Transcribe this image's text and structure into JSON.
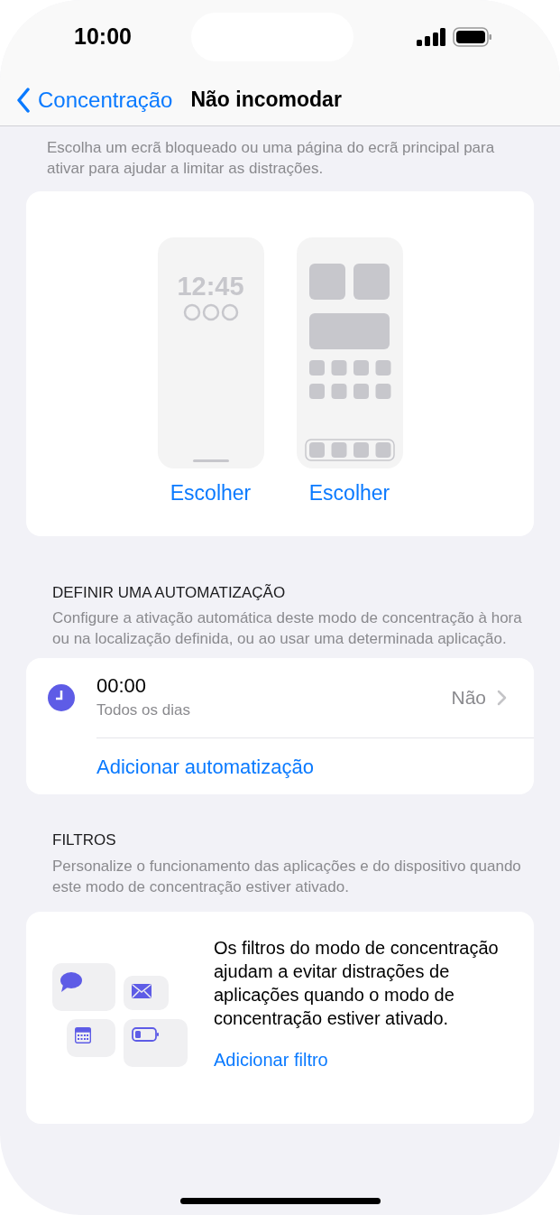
{
  "status_bar": {
    "time": "10:00"
  },
  "nav": {
    "back_label": "Concentração",
    "title": "Não incomodar"
  },
  "screens_section": {
    "description": "Escolha um ecrã bloqueado ou uma página do ecrã principal para ativar para ajudar a limitar as distrações.",
    "previews": [
      {
        "kind": "lock",
        "time": "12:45",
        "action": "Escolher"
      },
      {
        "kind": "home",
        "action": "Escolher"
      }
    ]
  },
  "automation_section": {
    "header": "DEFINIR UMA AUTOMATIZAÇÃO",
    "description": "Configure a ativação automática deste modo de concentração à hora ou na localização definida, ou ao usar uma determinada aplicação.",
    "items": [
      {
        "time": "00:00",
        "schedule": "Todos os dias",
        "value": "Não"
      }
    ],
    "add_label": "Adicionar automatização"
  },
  "filters_section": {
    "header": "FILTROS",
    "description": "Personalize o funcionamento das aplicações e do dispositivo quando este modo de concentração estiver ativado.",
    "info": "Os filtros do modo de concentração ajudam a evitar distrações de aplicações quando o modo de concentração estiver ativado.",
    "add_label": "Adicionar filtro"
  }
}
